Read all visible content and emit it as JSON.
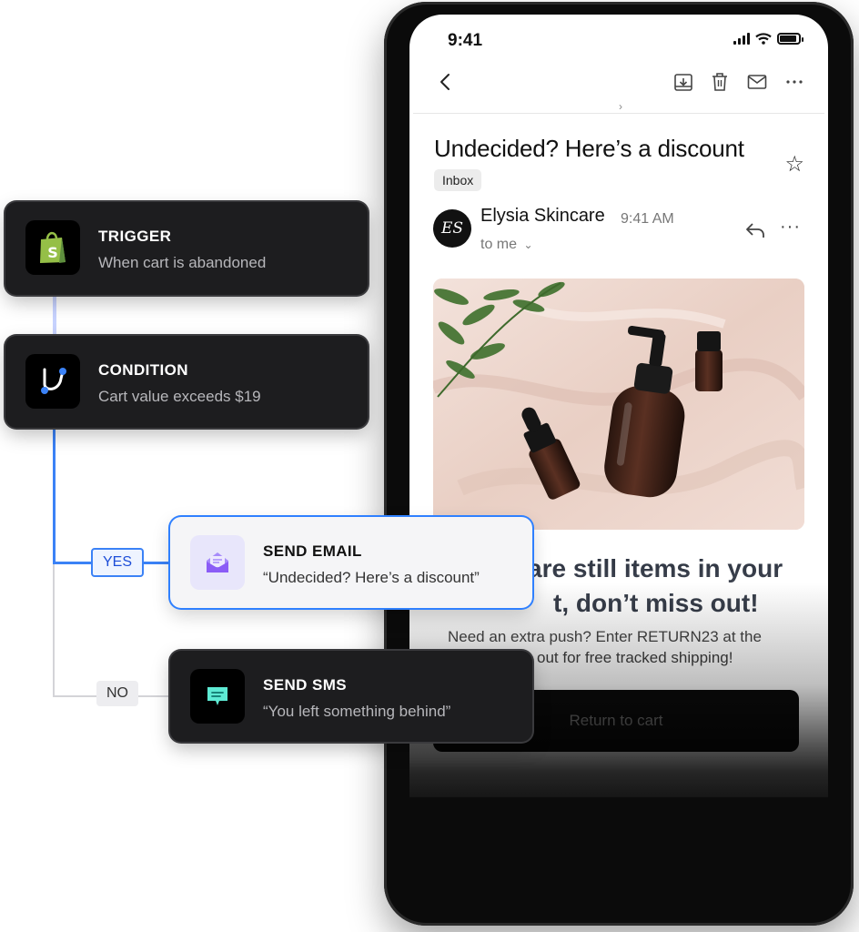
{
  "phone": {
    "status_time": "9:41",
    "toolbar_icons": [
      "back-chevron-icon",
      "archive-icon",
      "trash-icon",
      "mail-icon",
      "more-horizontal-icon"
    ],
    "subject": "Undecided? Here’s a discount",
    "folder_tag": "Inbox",
    "sender": {
      "avatar_initials": "ES",
      "name": "Elysia Skincare",
      "time": "9:41 AM",
      "recipient": "to me"
    },
    "email": {
      "headline_line1": "are still items in your",
      "headline_line2": "t, don’t miss out!",
      "body_line1": "Need an extra push? Enter RETURN23 at the",
      "body_line2": "out for free tracked shipping!",
      "cta": "Return to cart"
    }
  },
  "workflow": {
    "trigger": {
      "title": "TRIGGER",
      "subtitle": "When cart is abandoned",
      "icon": "shopify-bag-icon"
    },
    "condition": {
      "title": "CONDITION",
      "subtitle": "Cart value exceeds $19",
      "icon": "branch-icon"
    },
    "yes_label": "YES",
    "no_label": "NO",
    "send_email": {
      "title": "SEND EMAIL",
      "subtitle": "“Undecided? Here’s a discount”",
      "icon": "open-envelope-icon"
    },
    "send_sms": {
      "title": "SEND SMS",
      "subtitle": "“You left something behind”",
      "icon": "chat-bubble-icon"
    }
  },
  "colors": {
    "accent_blue": "#3b82f6",
    "card_dark": "#1d1d1f",
    "shopify_green": "#95bf47"
  }
}
